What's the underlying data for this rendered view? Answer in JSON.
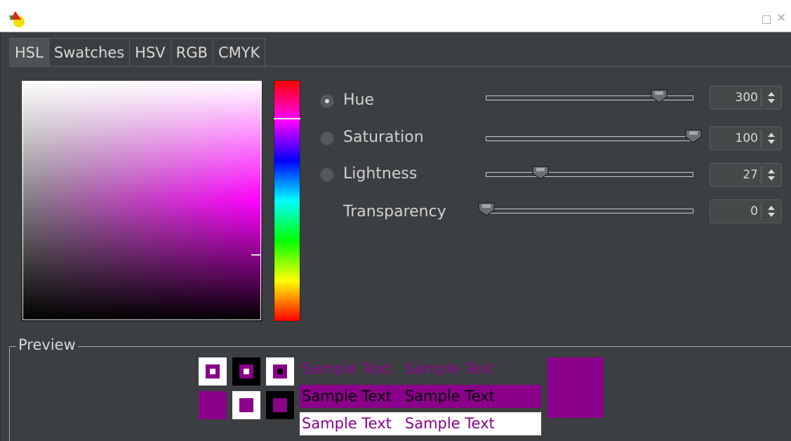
{
  "window": {
    "maximize_icon": "maximize-icon",
    "close_label": "✕"
  },
  "tabs": [
    "HSL",
    "Swatches",
    "HSV",
    "RGB",
    "CMYK"
  ],
  "selected_tab": "HSL",
  "colors": {
    "current": "#8a008a",
    "panel_bg": "#3c3f41"
  },
  "sliders": [
    {
      "label": "Hue",
      "value": "300",
      "selected": true,
      "max": 360,
      "level": 0.833
    },
    {
      "label": "Saturation",
      "value": "100",
      "selected": false,
      "max": 100,
      "level": 1.0
    },
    {
      "label": "Lightness",
      "value": "27",
      "selected": false,
      "max": 100,
      "level": 0.27
    },
    {
      "label": "Transparency",
      "value": "0",
      "selected": null,
      "max": 100,
      "level": 0.0
    }
  ],
  "preview": {
    "title": "Preview",
    "sample_text": "Sample Text"
  }
}
